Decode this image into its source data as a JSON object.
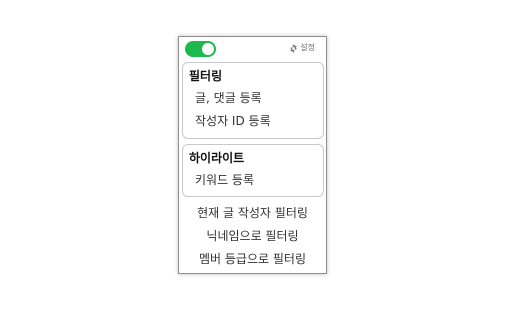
{
  "header": {
    "toggle": {
      "on": true,
      "color": "#1db94e"
    },
    "settings_label": "설정",
    "settings_icon": "gear-icon"
  },
  "sections": [
    {
      "title": "필터링",
      "items": [
        "글, 댓글 등록",
        "작성자 ID 등록"
      ]
    },
    {
      "title": "하이라이트",
      "items": [
        "키워드 등록"
      ]
    }
  ],
  "actions": [
    "현재 글 작성자 필터링",
    "닉네임으로 필터링",
    "멤버 등급으로 필터링"
  ]
}
